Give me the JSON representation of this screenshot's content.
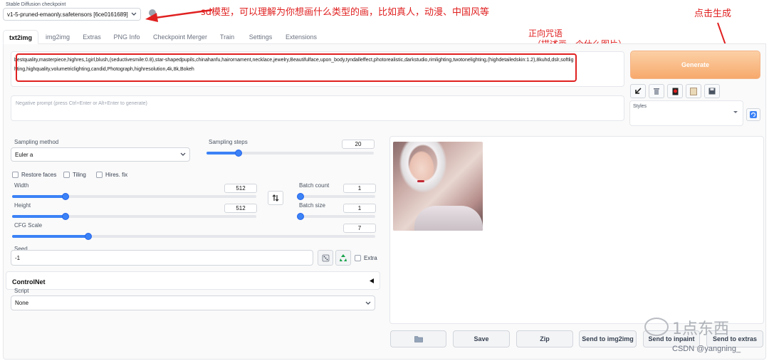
{
  "checkpoint": {
    "label": "Stable Diffusion checkpoint",
    "value": "v1-5-pruned-emaonly.safetensors [6ce0161689]"
  },
  "annotations": {
    "model": "sd模型，可以理解为你想画什么类型的画，比如真人，动漫、中国风等",
    "generate": "点击生成",
    "prompt_line1": "正向咒语",
    "prompt_line2": "（描述画一个什么图片）"
  },
  "tabs": [
    "txt2img",
    "img2img",
    "Extras",
    "PNG Info",
    "Checkpoint Merger",
    "Train",
    "Settings",
    "Extensions"
  ],
  "prompt": {
    "value": "bestquality,masterpiece,highres,1girl,blush,(seductivesmile:0.8),star-shapedpupils,chinahanfu,hairornament,necklace,jewelry,Beautifulface,upon_body,tyndalleffect,photorealistic,darkstudio,rimlighting,twotonelighting,(highdetailedskin:1.2),8kuhd,dslr,softlighting,highquality,volumetriclighting,candid,Photograph,highresolution,4k,8k,Bokeh"
  },
  "negative_prompt": {
    "placeholder": "Negative prompt (press Ctrl+Enter or Alt+Enter to generate)"
  },
  "generate_label": "Generate",
  "styles": {
    "label": "Styles"
  },
  "sampling": {
    "method_label": "Sampling method",
    "method_value": "Euler a",
    "steps_label": "Sampling steps",
    "steps_value": "20",
    "steps_fraction": 0.19
  },
  "checkboxes": [
    "Restore faces",
    "Tiling",
    "Hires. fix"
  ],
  "width": {
    "label": "Width",
    "value": "512",
    "fraction": 0.22
  },
  "height": {
    "label": "Height",
    "value": "512",
    "fraction": 0.22
  },
  "batch_count": {
    "label": "Batch count",
    "value": "1",
    "fraction": 0.0
  },
  "batch_size": {
    "label": "Batch size",
    "value": "1",
    "fraction": 0.0
  },
  "cfg": {
    "label": "CFG Scale",
    "value": "7",
    "fraction": 0.21
  },
  "seed": {
    "label": "Seed",
    "value": "-1",
    "extra_label": "Extra"
  },
  "controlnet": {
    "label": "ControlNet"
  },
  "script": {
    "label": "Script",
    "value": "None"
  },
  "output_buttons": [
    "Save",
    "Zip",
    "Send to img2img",
    "Send to inpaint",
    "Send to extras"
  ],
  "watermark": {
    "brand": "1点东西",
    "credit": "CSDN @yangning_"
  },
  "colors": {
    "accent": "#3b82f6",
    "generate": "#f7a96c",
    "annotation": "#e02020"
  }
}
